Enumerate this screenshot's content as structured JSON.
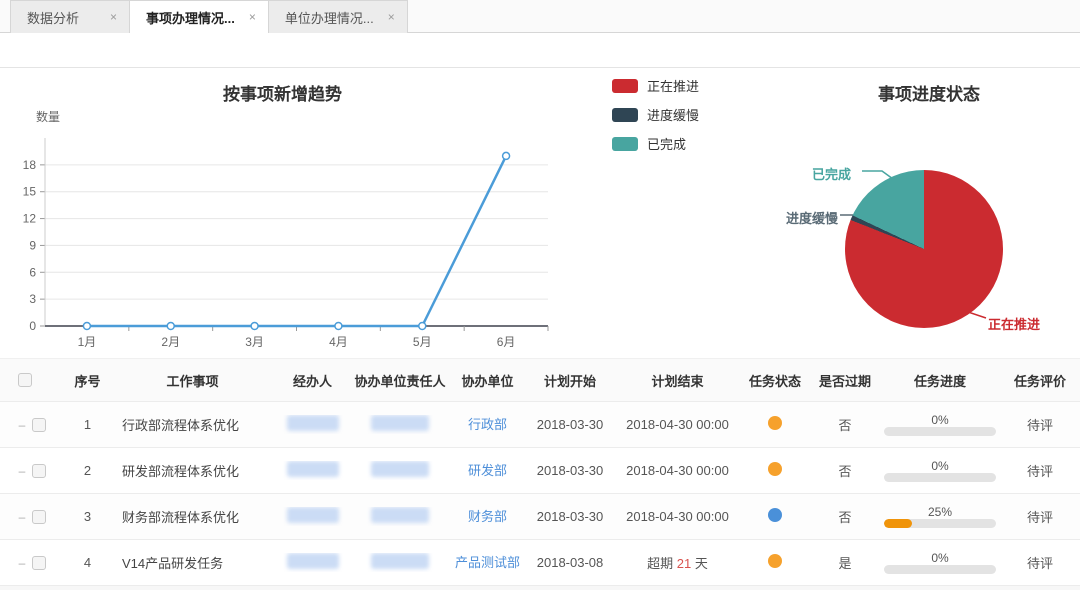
{
  "tabs": [
    {
      "label": "数据分析",
      "close": "×",
      "active": false
    },
    {
      "label": "事项办理情况...",
      "close": "×",
      "active": true
    },
    {
      "label": "单位办理情况...",
      "close": "×",
      "active": false
    }
  ],
  "legend": {
    "items": [
      {
        "label": "正在推进",
        "color": "#cb2b30"
      },
      {
        "label": "进度缓慢",
        "color": "#2f4554"
      },
      {
        "label": "已完成",
        "color": "#48a5a0"
      }
    ]
  },
  "chart_data": [
    {
      "type": "line",
      "title": "按事项新增趋势",
      "ylabel": "数量",
      "categories": [
        "1月",
        "2月",
        "3月",
        "4月",
        "5月",
        "6月"
      ],
      "values": [
        0,
        0,
        0,
        0,
        0,
        19
      ],
      "yticks": [
        0,
        3,
        6,
        9,
        12,
        15,
        18
      ],
      "ylim": [
        0,
        21
      ],
      "line_color": "#4b9cd8",
      "grid": true,
      "legend_position": "top-right"
    },
    {
      "type": "pie",
      "title": "事项进度状态",
      "slices": [
        {
          "label": "正在推进",
          "value": 81,
          "color": "#cb2b30"
        },
        {
          "label": "进度缓慢",
          "value": 1,
          "color": "#2f4554"
        },
        {
          "label": "已完成",
          "value": 18,
          "color": "#48a5a0"
        }
      ],
      "value_unit": "percent_estimated"
    }
  ],
  "table": {
    "headers": [
      "序号",
      "工作事项",
      "经办人",
      "协办单位责任人",
      "协办单位",
      "计划开始",
      "计划结束",
      "任务状态",
      "是否过期",
      "任务进度",
      "任务评价"
    ],
    "status_colors": {
      "orange": "#f6a12c",
      "blue": "#4a90d9"
    },
    "rows": [
      {
        "seq": "1",
        "item": "行政部流程体系优化",
        "handler_redacted": true,
        "manager_redacted": true,
        "unit": "行政部",
        "plan_start": "2018-03-30",
        "plan_end": "2018-04-30 00:00",
        "status": "orange",
        "expired": "否",
        "progress_pct": 0,
        "progress_label": "0%",
        "evaluation": "待评"
      },
      {
        "seq": "2",
        "item": "研发部流程体系优化",
        "handler_redacted": true,
        "manager_redacted": true,
        "unit": "研发部",
        "plan_start": "2018-03-30",
        "plan_end": "2018-04-30 00:00",
        "status": "orange",
        "expired": "否",
        "progress_pct": 0,
        "progress_label": "0%",
        "evaluation": "待评"
      },
      {
        "seq": "3",
        "item": "财务部流程体系优化",
        "handler_redacted": true,
        "manager_redacted": true,
        "unit": "财务部",
        "plan_start": "2018-03-30",
        "plan_end": "2018-04-30 00:00",
        "status": "blue",
        "expired": "否",
        "progress_pct": 25,
        "progress_label": "25%",
        "evaluation": "待评"
      },
      {
        "seq": "4",
        "item": "V14产品研发任务",
        "handler_redacted": true,
        "manager_redacted": true,
        "unit": "产品测试部",
        "plan_start": "2018-03-08",
        "plan_end_overdue": {
          "prefix": "超期",
          "days": "21",
          "suffix": "天"
        },
        "status": "orange",
        "expired": "是",
        "progress_pct": 0,
        "progress_label": "0%",
        "evaluation": "待评"
      }
    ]
  }
}
